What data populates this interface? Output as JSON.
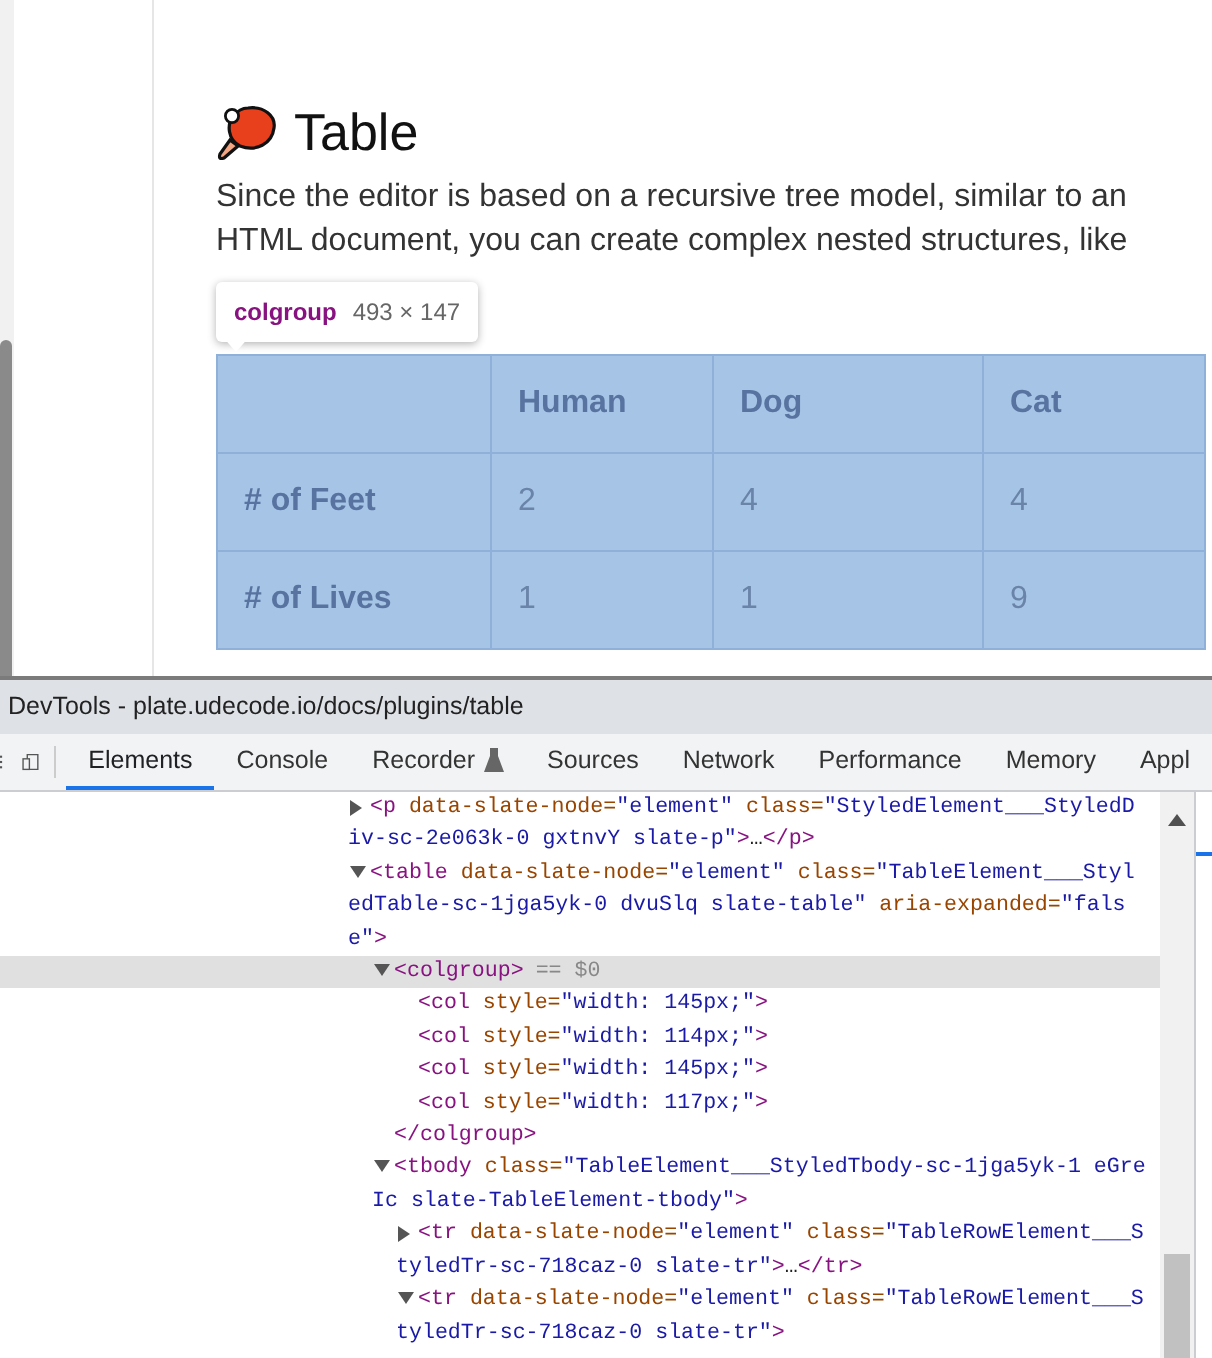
{
  "page": {
    "heading": "Table",
    "paragraph": "Since the editor is based on a recursive tree model, similar to an HTML document, you can create complex nested structures, like",
    "tooltip": {
      "tag": "colgroup",
      "size": "493 × 147"
    },
    "table": {
      "columns": [
        "Human",
        "Dog",
        "Cat"
      ],
      "rows": [
        {
          "label": "# of Feet",
          "cells": [
            "2",
            "4",
            "4"
          ]
        },
        {
          "label": "# of Lives",
          "cells": [
            "1",
            "1",
            "9"
          ]
        }
      ]
    }
  },
  "devtools": {
    "title": "DevTools - plate.udecode.io/docs/plugins/table",
    "tabs": [
      {
        "label": "Elements",
        "selected": true
      },
      {
        "label": "Console",
        "selected": false
      },
      {
        "label": "Recorder",
        "selected": false,
        "kind": "flask"
      },
      {
        "label": "Sources",
        "selected": false
      },
      {
        "label": "Network",
        "selected": false
      },
      {
        "label": "Performance",
        "selected": false
      },
      {
        "label": "Memory",
        "selected": false
      },
      {
        "label": "Appl",
        "selected": false
      }
    ],
    "dom": [
      {
        "lines": [
          "<p data-slate-node=\"element\" class=\"StyledElement___StyledD",
          "iv-sc-2e063k-0 gxtnvY slate-p\">…</p>"
        ],
        "expanded": false,
        "selected": false
      },
      {
        "lines": [
          "<table data-slate-node=\"element\" class=\"TableElement___Styl",
          "edTable-sc-1jga5yk-0 dvuSlq slate-table\" aria-expanded=\"fals",
          "e\">"
        ],
        "expanded": true,
        "selected": false,
        "children": [
          {
            "lines": [
              "<colgroup>"
            ],
            "marker": "== $0",
            "expanded": true,
            "selected": true,
            "closing": "</colgroup>",
            "children": [
              {
                "lines": [
                  "<col style=\"width: 145px;\">"
                ],
                "selected": false
              },
              {
                "lines": [
                  "<col style=\"width: 114px;\">"
                ],
                "selected": false
              },
              {
                "lines": [
                  "<col style=\"width: 145px;\">"
                ],
                "selected": false
              },
              {
                "lines": [
                  "<col style=\"width: 117px;\">"
                ],
                "selected": false
              }
            ]
          },
          {
            "lines": [
              "<tbody class=\"TableElement___StyledTbody-sc-1jga5yk-1 eGre",
              "Ic slate-TableElement-tbody\">"
            ],
            "expanded": true,
            "selected": false,
            "children": [
              {
                "lines": [
                  "<tr data-slate-node=\"element\" class=\"TableRowElement___S",
                  "tyledTr-sc-718caz-0 slate-tr\">…</tr>"
                ],
                "expanded": false,
                "selected": false
              },
              {
                "lines": [
                  "<tr data-slate-node=\"element\" class=\"TableRowElement___S",
                  "tyledTr-sc-718caz-0 slate-tr\">"
                ],
                "expanded": true,
                "selected": false
              }
            ]
          }
        ]
      }
    ]
  }
}
